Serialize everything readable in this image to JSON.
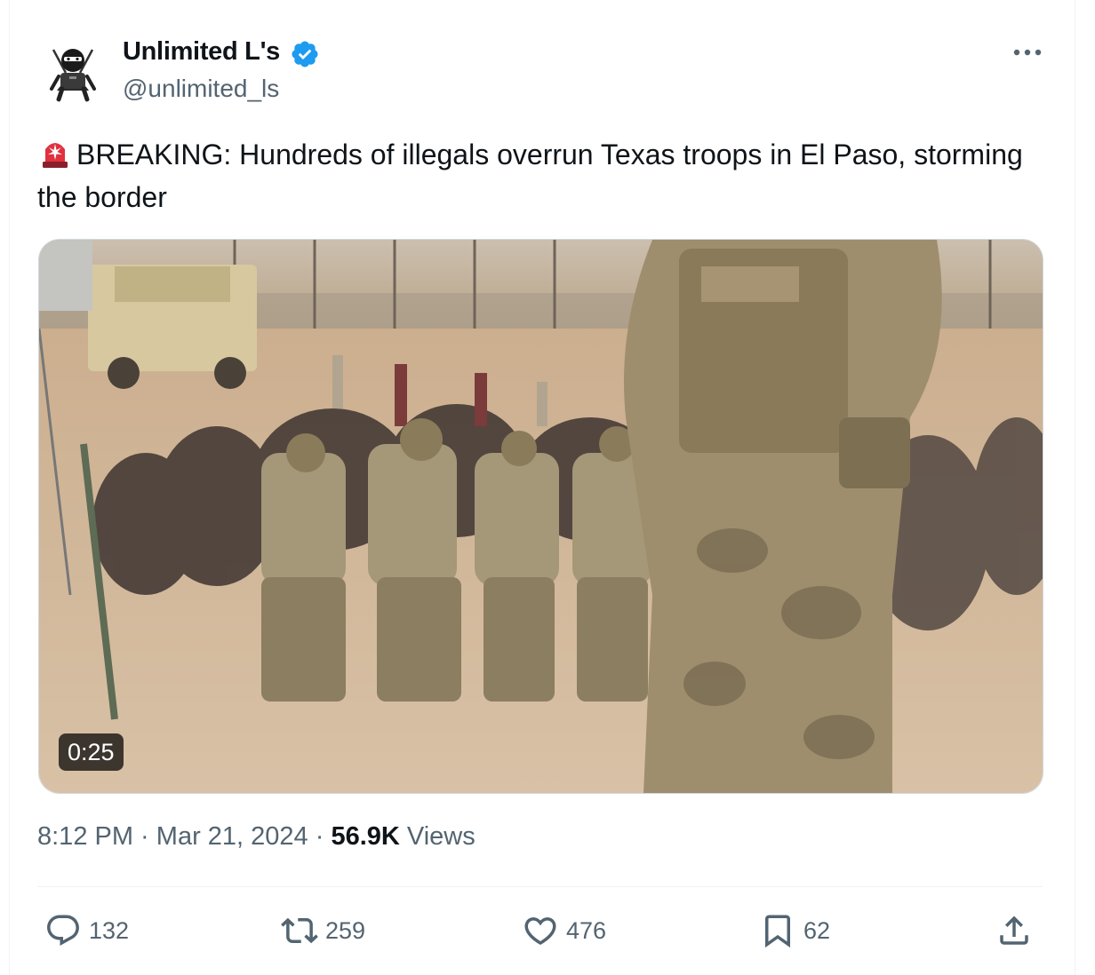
{
  "author": {
    "display_name": "Unlimited L's",
    "handle": "@unlimited_ls",
    "avatar_icon": "ninja-avatar-icon",
    "verified_color": "#1d9bf0"
  },
  "post": {
    "text": "BREAKING: Hundreds of illegals overrun Texas troops in El Paso, storming the border",
    "emoji": "police-siren-emoji"
  },
  "media": {
    "type": "video",
    "duration": "0:25"
  },
  "meta": {
    "time": "8:12 PM",
    "sep1": " · ",
    "date": "Mar 21, 2024",
    "sep2": " · ",
    "views_count": "56.9K",
    "views_label": " Views"
  },
  "actions": {
    "replies": "132",
    "reposts": "259",
    "likes": "476",
    "bookmarks": "62"
  },
  "colors": {
    "text_primary": "#0f1419",
    "text_secondary": "#536471",
    "accent": "#1d9bf0"
  }
}
